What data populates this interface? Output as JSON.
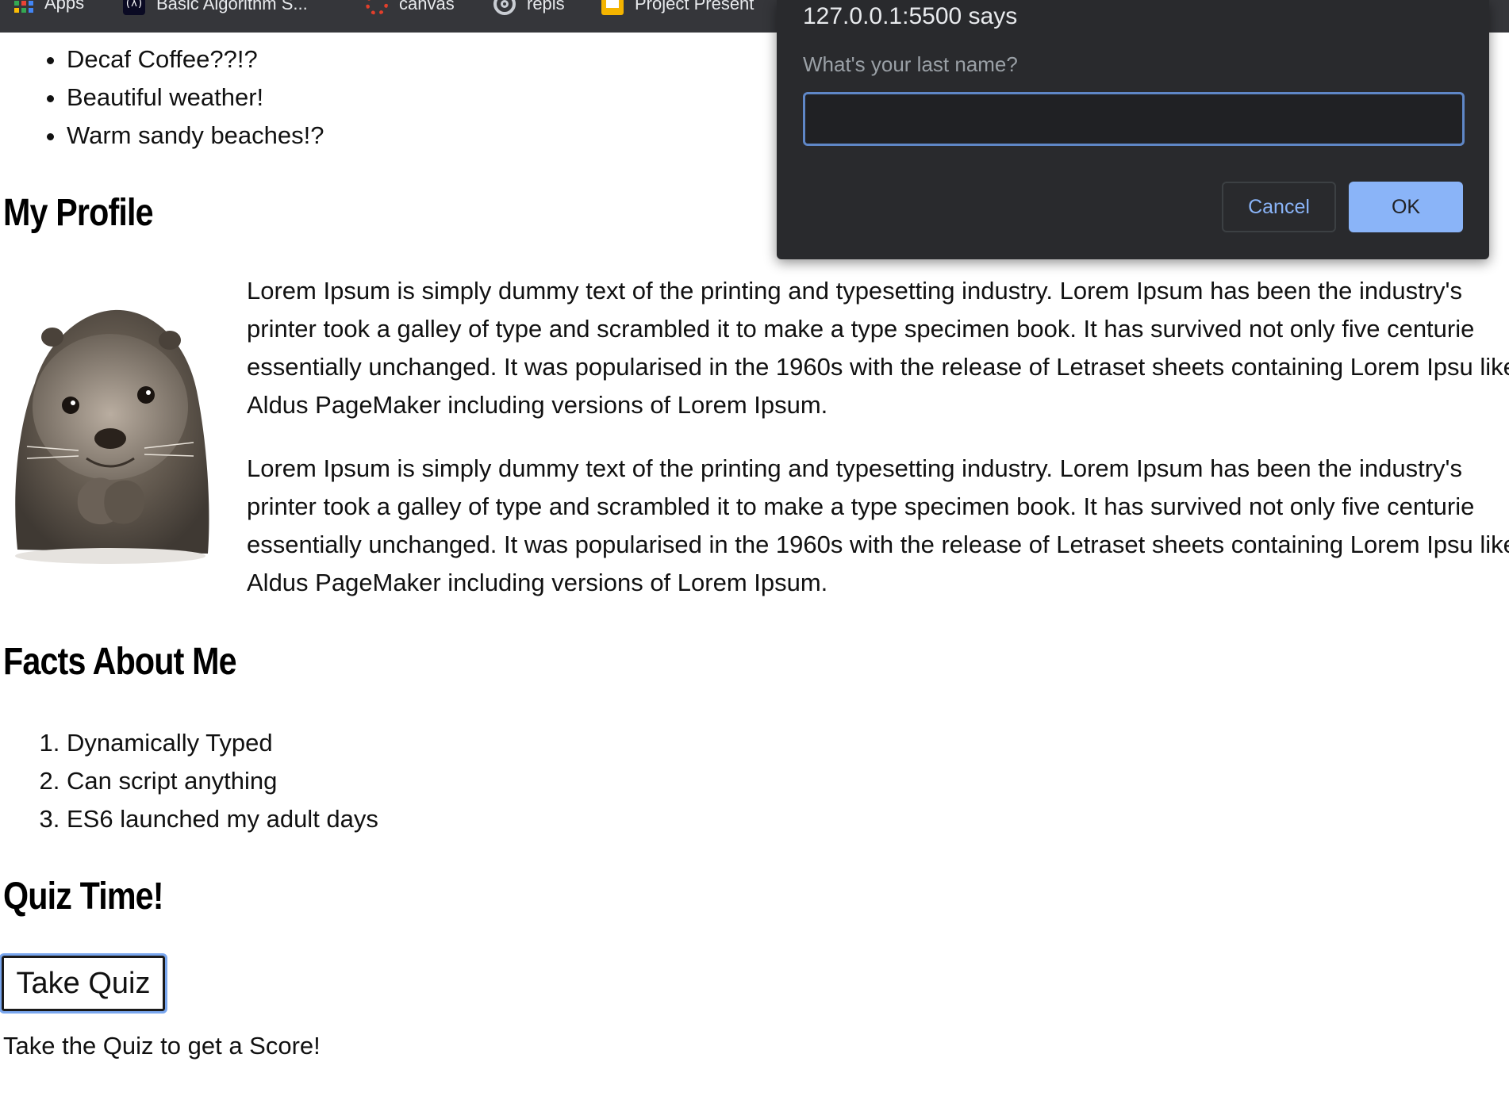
{
  "bookmarks": [
    {
      "label": "Apps",
      "icon": "apps-grid-icon"
    },
    {
      "label": "Basic Algorithm S...",
      "icon": "freecodecamp-icon"
    },
    {
      "label": "canvas",
      "icon": "canvas-icon"
    },
    {
      "label": "repls",
      "icon": "replit-icon"
    },
    {
      "label": "Project Present",
      "icon": "slides-icon"
    }
  ],
  "likes_list": [
    "Decaf Coffee??!?",
    "Beautiful weather!",
    "Warm sandy beaches!?"
  ],
  "profile": {
    "heading": "My Profile",
    "paragraphs": [
      "Lorem Ipsum is simply dummy text of the printing and typesetting industry. Lorem Ipsum has been the industry's printer took a galley of type and scrambled it to make a type specimen book. It has survived not only five centurie essentially unchanged. It was popularised in the 1960s with the release of Letraset sheets containing Lorem Ipsu like Aldus PageMaker including versions of Lorem Ipsum.",
      "Lorem Ipsum is simply dummy text of the printing and typesetting industry. Lorem Ipsum has been the industry's printer took a galley of type and scrambled it to make a type specimen book. It has survived not only five centurie essentially unchanged. It was popularised in the 1960s with the release of Letraset sheets containing Lorem Ipsu like Aldus PageMaker including versions of Lorem Ipsum."
    ]
  },
  "facts": {
    "heading": "Facts About Me",
    "items": [
      "Dynamically Typed",
      "Can script anything",
      "ES6 launched my adult days"
    ]
  },
  "quiz": {
    "heading": "Quiz Time!",
    "button_label": "Take Quiz",
    "score_text": "Take the Quiz to get a Score!"
  },
  "dialog": {
    "title": "127.0.0.1:5500 says",
    "message": "What's your last name?",
    "input_value": "",
    "cancel_label": "Cancel",
    "ok_label": "OK"
  },
  "colors": {
    "bookmarks_bar": "#35363a",
    "dialog_bg": "#292a2d",
    "dialog_accent": "#8ab4f8",
    "focus_ring": "#7aa7ef"
  }
}
